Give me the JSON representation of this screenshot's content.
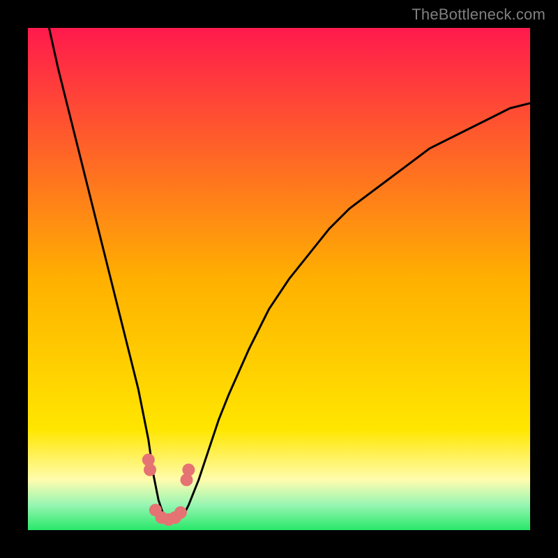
{
  "watermark": "TheBottleneck.com",
  "colors": {
    "topGradient": "#ff1a4d",
    "midGradient": "#ffe600",
    "paleYellow": "#fffcae",
    "green": "#28e86a",
    "greenLight": "#97f5b2",
    "curve": "#000000",
    "marker": "#e57373"
  },
  "chart_data": {
    "type": "line",
    "title": "",
    "xlabel": "",
    "ylabel": "",
    "xlim": [
      0,
      100
    ],
    "ylim": [
      0,
      100
    ],
    "x": [
      0,
      2,
      4,
      6,
      8,
      10,
      12,
      14,
      16,
      18,
      20,
      22,
      24,
      25,
      26,
      27,
      28,
      29,
      30,
      31,
      32,
      34,
      36,
      38,
      40,
      44,
      48,
      52,
      56,
      60,
      64,
      68,
      72,
      76,
      80,
      84,
      88,
      92,
      96,
      100
    ],
    "series": [
      {
        "name": "bottleneck-curve",
        "values": [
          120,
          110,
          101,
          92,
          84,
          76,
          68,
          60,
          52,
          44,
          36,
          28,
          18,
          11,
          6,
          3,
          2,
          2,
          2,
          3,
          5,
          10,
          16,
          22,
          27,
          36,
          44,
          50,
          55,
          60,
          64,
          67,
          70,
          73,
          76,
          78,
          80,
          82,
          84,
          85
        ]
      }
    ],
    "markers": {
      "name": "highlighted-points",
      "color": "#e57373",
      "points": [
        {
          "x": 24.0,
          "y": 14
        },
        {
          "x": 24.3,
          "y": 12
        },
        {
          "x": 25.4,
          "y": 4.0
        },
        {
          "x": 26.6,
          "y": 2.5
        },
        {
          "x": 28.0,
          "y": 2.1
        },
        {
          "x": 29.3,
          "y": 2.5
        },
        {
          "x": 30.4,
          "y": 3.5
        },
        {
          "x": 31.6,
          "y": 10
        },
        {
          "x": 32.0,
          "y": 12
        }
      ]
    }
  }
}
